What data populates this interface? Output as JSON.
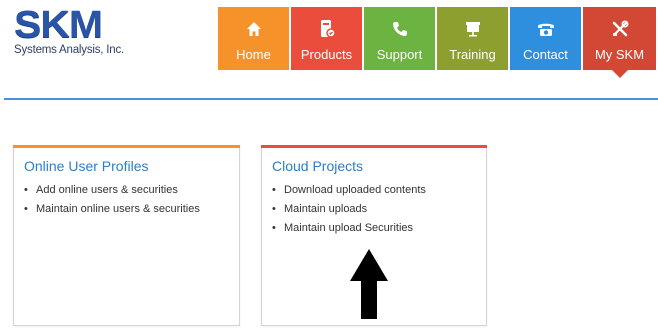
{
  "logo": {
    "wordmark": "SKM",
    "tagline": "Systems Analysis, Inc."
  },
  "nav": {
    "items": [
      {
        "label": "Home",
        "icon": "home-icon"
      },
      {
        "label": "Products",
        "icon": "products-icon"
      },
      {
        "label": "Support",
        "icon": "phone-icon"
      },
      {
        "label": "Training",
        "icon": "presentation-icon"
      },
      {
        "label": "Contact",
        "icon": "telephone-icon"
      },
      {
        "label": "My SKM",
        "icon": "tools-icon"
      }
    ],
    "active": "My SKM"
  },
  "cards": [
    {
      "title": "Online User Profiles",
      "items": [
        "Add online users & securities",
        "Maintain online users & securities"
      ]
    },
    {
      "title": "Cloud Projects",
      "items": [
        "Download uploaded contents",
        "Maintain uploads",
        "Maintain upload Securities"
      ]
    }
  ],
  "colors": {
    "home": "#f5932a",
    "products": "#ea4d3c",
    "support": "#6db341",
    "training": "#8d9f2f",
    "contact": "#2f8fdf",
    "myskm": "#d24834",
    "accent_rule": "#4a90de",
    "card_title": "#2b7fc7"
  }
}
